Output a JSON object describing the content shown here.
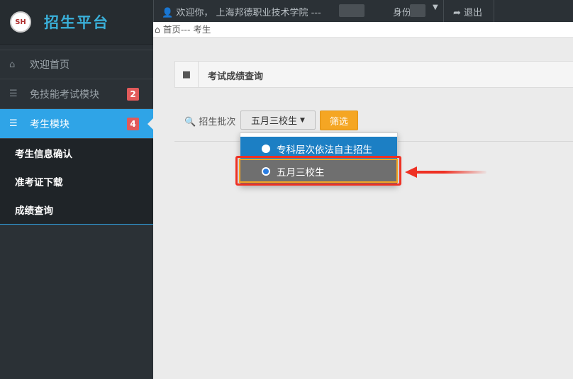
{
  "sidebar": {
    "brand_title": "招生平台",
    "logo_text": "SH",
    "items": [
      {
        "label": "欢迎首页",
        "icon": "home-icon",
        "badge": ""
      },
      {
        "label": "免技能考试模块",
        "icon": "list-icon",
        "badge": "2"
      },
      {
        "label": "考生模块",
        "icon": "list-icon",
        "badge": "4"
      }
    ],
    "submenu": [
      "考生信息确认",
      "准考证下载",
      "成绩查询"
    ]
  },
  "topbar": {
    "welcome": "欢迎你， 上海邦德职业技术学院 ---",
    "role_label": "身份:",
    "logout": "退出"
  },
  "breadcrumb": "首页--- 考生",
  "panel": {
    "title": "考试成绩查询"
  },
  "filter": {
    "label": "招生批次",
    "selected": "五月三校生",
    "button": "筛选",
    "options": [
      "专科层次依法自主招生",
      "五月三校生"
    ]
  },
  "colors": {
    "accent": "#2fa4e7",
    "highlight": "#ee3124",
    "button": "#f5a623",
    "brand": "#3ab0d9"
  }
}
